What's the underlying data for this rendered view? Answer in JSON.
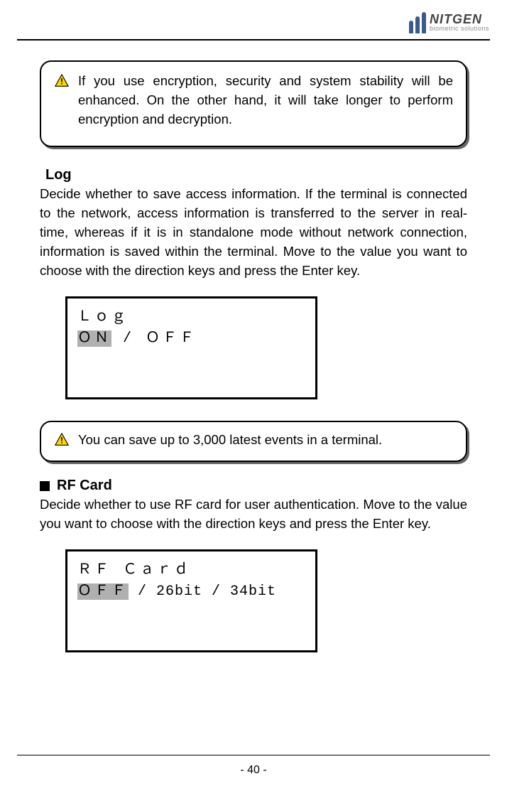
{
  "header": {
    "logo_name": "NITGEN",
    "logo_tagline": "biometric solutions"
  },
  "notice1": {
    "text": "If you use encryption, security and system stability will be enhanced. On the other hand, it will take longer to perform encryption and decryption."
  },
  "section_log": {
    "heading": "Log",
    "body": "Decide whether to save access information. If the terminal is connected to the network, access information is transferred to the server in real-time, whereas if it is in standalone mode without network connection, information is saved within the terminal. Move to the value you want to choose with the direction keys and press the Enter key.",
    "terminal_title": "Ｌｏｇ",
    "option_selected": "ＯＮ",
    "separator": " / ",
    "option_other": "ＯＦＦ"
  },
  "notice2": {
    "text": "You can save up to 3,000 latest events in a terminal."
  },
  "section_rfcard": {
    "heading": "RF Card",
    "body": "Decide whether to use RF card for user authentication. Move to the value you want to choose with the direction keys and press the Enter key.",
    "terminal_title": "ＲＦ Ｃａｒｄ",
    "option_selected": "ＯＦＦ",
    "separator": " / ",
    "option_26": "26bit",
    "option_34": "34bit"
  },
  "page_number": "- 40 -"
}
